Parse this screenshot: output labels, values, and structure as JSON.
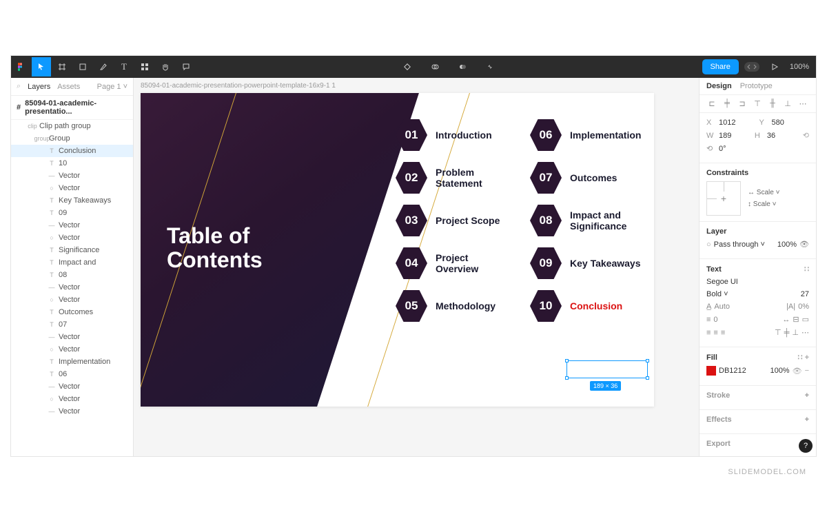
{
  "toolbar": {
    "share_label": "Share",
    "zoom": "100%"
  },
  "left_panel": {
    "tabs": {
      "layers": "Layers",
      "assets": "Assets"
    },
    "page": "Page 1",
    "file_name": "85094-01-academic-presentatio...",
    "layers": [
      {
        "icon": "clip",
        "label": "Clip path group",
        "level": 1
      },
      {
        "icon": "group",
        "label": "Group",
        "level": 2
      },
      {
        "icon": "T",
        "label": "Conclusion",
        "level": 3,
        "selected": true
      },
      {
        "icon": "T",
        "label": "10",
        "level": 3
      },
      {
        "icon": "—",
        "label": "Vector",
        "level": 3
      },
      {
        "icon": "○",
        "label": "Vector",
        "level": 3
      },
      {
        "icon": "T",
        "label": "Key Takeaways",
        "level": 3
      },
      {
        "icon": "T",
        "label": "09",
        "level": 3
      },
      {
        "icon": "—",
        "label": "Vector",
        "level": 3
      },
      {
        "icon": "○",
        "label": "Vector",
        "level": 3
      },
      {
        "icon": "T",
        "label": "Significance",
        "level": 3
      },
      {
        "icon": "T",
        "label": "Impact and",
        "level": 3
      },
      {
        "icon": "T",
        "label": "08",
        "level": 3
      },
      {
        "icon": "—",
        "label": "Vector",
        "level": 3
      },
      {
        "icon": "○",
        "label": "Vector",
        "level": 3
      },
      {
        "icon": "T",
        "label": "Outcomes",
        "level": 3
      },
      {
        "icon": "T",
        "label": "07",
        "level": 3
      },
      {
        "icon": "—",
        "label": "Vector",
        "level": 3
      },
      {
        "icon": "○",
        "label": "Vector",
        "level": 3
      },
      {
        "icon": "T",
        "label": "Implementation",
        "level": 3
      },
      {
        "icon": "T",
        "label": "06",
        "level": 3
      },
      {
        "icon": "—",
        "label": "Vector",
        "level": 3
      },
      {
        "icon": "○",
        "label": "Vector",
        "level": 3
      },
      {
        "icon": "—",
        "label": "Vector",
        "level": 3
      }
    ]
  },
  "canvas": {
    "frame_label": "85094-01-academic-presentation-powerpoint-template-16x9-1 1",
    "title_line1": "Table of",
    "title_line2": "Contents",
    "items_col1": [
      {
        "num": "01",
        "label": "Introduction"
      },
      {
        "num": "02",
        "label": "Problem Statement"
      },
      {
        "num": "03",
        "label": "Project Scope"
      },
      {
        "num": "04",
        "label": "Project Overview"
      },
      {
        "num": "05",
        "label": "Methodology"
      }
    ],
    "items_col2": [
      {
        "num": "06",
        "label": "Implementation"
      },
      {
        "num": "07",
        "label": "Outcomes"
      },
      {
        "num": "08",
        "label": "Impact and Significance"
      },
      {
        "num": "09",
        "label": "Key Takeaways"
      },
      {
        "num": "10",
        "label": "Conclusion",
        "selected": true
      }
    ],
    "selection_dims": "189 × 36"
  },
  "right_panel": {
    "tabs": {
      "design": "Design",
      "prototype": "Prototype"
    },
    "position": {
      "x_label": "X",
      "x": "1012",
      "y_label": "Y",
      "y": "580",
      "w_label": "W",
      "w": "189",
      "h_label": "H",
      "h": "36",
      "rot_label": "⟲",
      "rot": "0°"
    },
    "constraints": {
      "title": "Constraints",
      "h": "Scale",
      "v": "Scale"
    },
    "layer": {
      "title": "Layer",
      "blend": "Pass through",
      "opacity": "100%"
    },
    "text": {
      "title": "Text",
      "font": "Segoe UI",
      "weight": "Bold",
      "size": "27",
      "line_height_mode": "Auto",
      "letter_spacing": "0%",
      "paragraph": "0"
    },
    "fill": {
      "title": "Fill",
      "hex": "DB1212",
      "opacity": "100%"
    },
    "stroke": {
      "title": "Stroke"
    },
    "effects": {
      "title": "Effects"
    },
    "export": {
      "title": "Export"
    }
  },
  "watermark": "SLIDEMODEL.COM"
}
